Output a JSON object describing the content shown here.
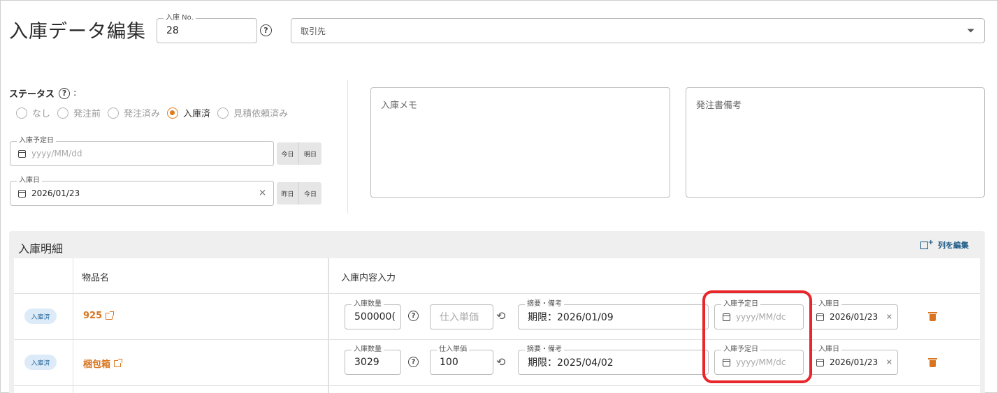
{
  "header": {
    "title": "入庫データ編集",
    "receipt_no_label": "入庫 No.",
    "receipt_no_value": "28",
    "supplier_placeholder": "取引先"
  },
  "status": {
    "label": "ステータス",
    "colon": ":",
    "options": [
      "なし",
      "発注前",
      "発注済み",
      "入庫済",
      "見積依頼済み"
    ],
    "selected": "入庫済"
  },
  "scheduled_date": {
    "label": "入庫予定日",
    "placeholder": "yyyy/MM/dd",
    "btn_today": "今日",
    "btn_tomorrow": "明日"
  },
  "receipt_date": {
    "label": "入庫日",
    "value": "2026/01/23",
    "btn_yesterday": "昨日",
    "btn_today": "今日"
  },
  "memo": {
    "receipt_memo_placeholder": "入庫メモ",
    "order_note_placeholder": "発注書備考"
  },
  "detail": {
    "title": "入庫明細",
    "edit_columns_label": "列を編集",
    "columns": [
      "",
      "物品名",
      "入庫内容入力"
    ],
    "rows": [
      {
        "badge": "入庫済",
        "item_name": "925",
        "qty_label": "入庫数量",
        "qty_value": "500000(",
        "price_label": "",
        "price_placeholder": "仕入単価",
        "price_value": "",
        "note_label": "摘要・備考",
        "note_value": "期限：2026/01/09",
        "sched_label": "入庫予定日",
        "sched_placeholder": "yyyy/MM/dc",
        "recv_label": "入庫日",
        "recv_value": "2026/01/23"
      },
      {
        "badge": "入庫済",
        "item_name": "梱包箱",
        "qty_label": "入庫数量",
        "qty_value": "3029",
        "price_label": "仕入単価",
        "price_placeholder": "",
        "price_value": "100",
        "note_label": "摘要・備考",
        "note_value": "期限：2025/04/02",
        "sched_label": "入庫予定日",
        "sched_placeholder": "yyyy/MM/dc",
        "recv_label": "入庫日",
        "recv_value": "2026/01/23"
      }
    ]
  },
  "colors": {
    "accent_orange": "#e07a1c",
    "badge_blue": "#dcebf7",
    "highlight_red": "#e8262b",
    "link_blue": "#1a5a85"
  }
}
